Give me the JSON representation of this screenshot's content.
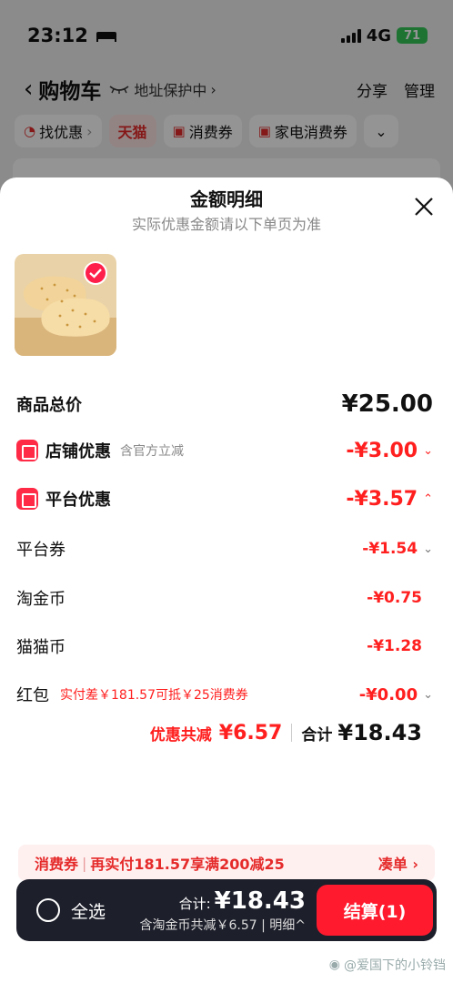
{
  "status": {
    "time": "23:12",
    "network": "4G",
    "battery": "71"
  },
  "header": {
    "back": "‹",
    "title": "购物车",
    "address": "地址保护中",
    "share": "分享",
    "manage": "管理"
  },
  "chips": [
    {
      "label": "找优惠",
      "icon": "clock-icon"
    },
    {
      "label": "天猫"
    },
    {
      "label": "消费券",
      "icon": "coupon-icon"
    },
    {
      "label": "家电消费券",
      "icon": "coupon-icon"
    }
  ],
  "sheet": {
    "title": "金额明细",
    "subtitle": "实际优惠金额请以下单页为准",
    "rows": {
      "total": {
        "label": "商品总价",
        "value": "¥25.00"
      },
      "shop": {
        "label": "店铺优惠",
        "note": "含官方立减",
        "value": "-¥3.00"
      },
      "platform": {
        "label": "平台优惠",
        "value": "-¥3.57"
      },
      "platform_coupon": {
        "label": "平台券",
        "value": "-¥1.54"
      },
      "taojinbi": {
        "label": "淘金币",
        "value": "-¥0.75"
      },
      "maomaobi": {
        "label": "猫猫币",
        "value": "-¥1.28"
      },
      "hongbao": {
        "label": "红包",
        "note": "实付差￥181.57可抵￥25消费券",
        "value": "-¥0.00"
      }
    },
    "summary": {
      "discount_label": "优惠共减",
      "discount_value": "¥6.57",
      "total_label": "合计",
      "total_value": "¥18.43"
    }
  },
  "coupon_bar": {
    "label": "消费券",
    "text": "再实付181.57享满200减25",
    "action": "凑单 ›"
  },
  "bottom_bar": {
    "select_all": "全选",
    "sum_label": "合计:",
    "sum_value": "¥18.43",
    "sum_sub": "含淘金币共减￥6.57 | 明细^",
    "checkout": "结算(1)"
  },
  "watermark": "@爱国下的小铃铛",
  "colors": {
    "accent": "#ff1f1f",
    "checkout": "#ff1a2e",
    "bar_bg": "#1d1f2b"
  }
}
